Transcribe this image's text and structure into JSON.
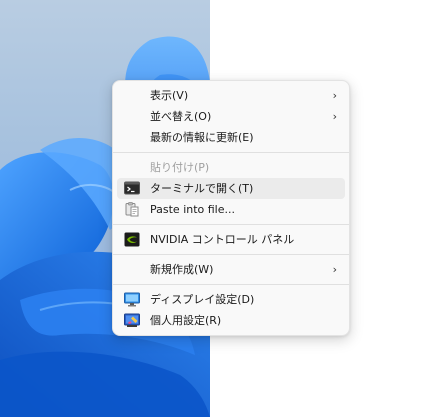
{
  "menu": {
    "items": [
      {
        "label": "表示(V)",
        "submenu_arrow": "›"
      },
      {
        "label": "並べ替え(O)",
        "submenu_arrow": "›"
      },
      {
        "label": "最新の情報に更新(E)"
      },
      {
        "label": "貼り付け(P)"
      },
      {
        "label": "ターミナルで開く(T)",
        "icon": "terminal-icon"
      },
      {
        "label": "Paste into file...",
        "icon": "paste-file-icon"
      },
      {
        "label": "NVIDIA コントロール パネル",
        "icon": "nvidia-icon"
      },
      {
        "label": "新規作成(W)",
        "submenu_arrow": "›"
      },
      {
        "label": "ディスプレイ設定(D)",
        "icon": "display-settings-icon"
      },
      {
        "label": "個人用設定(R)",
        "icon": "personalize-icon"
      }
    ]
  },
  "colors": {
    "menu_bg": "#f9f9f9",
    "hover_bg": "#ebebeb",
    "disabled_text": "#a0a0a0",
    "wallpaper_blue": "#1a73e8",
    "nvidia_green": "#76b900"
  }
}
